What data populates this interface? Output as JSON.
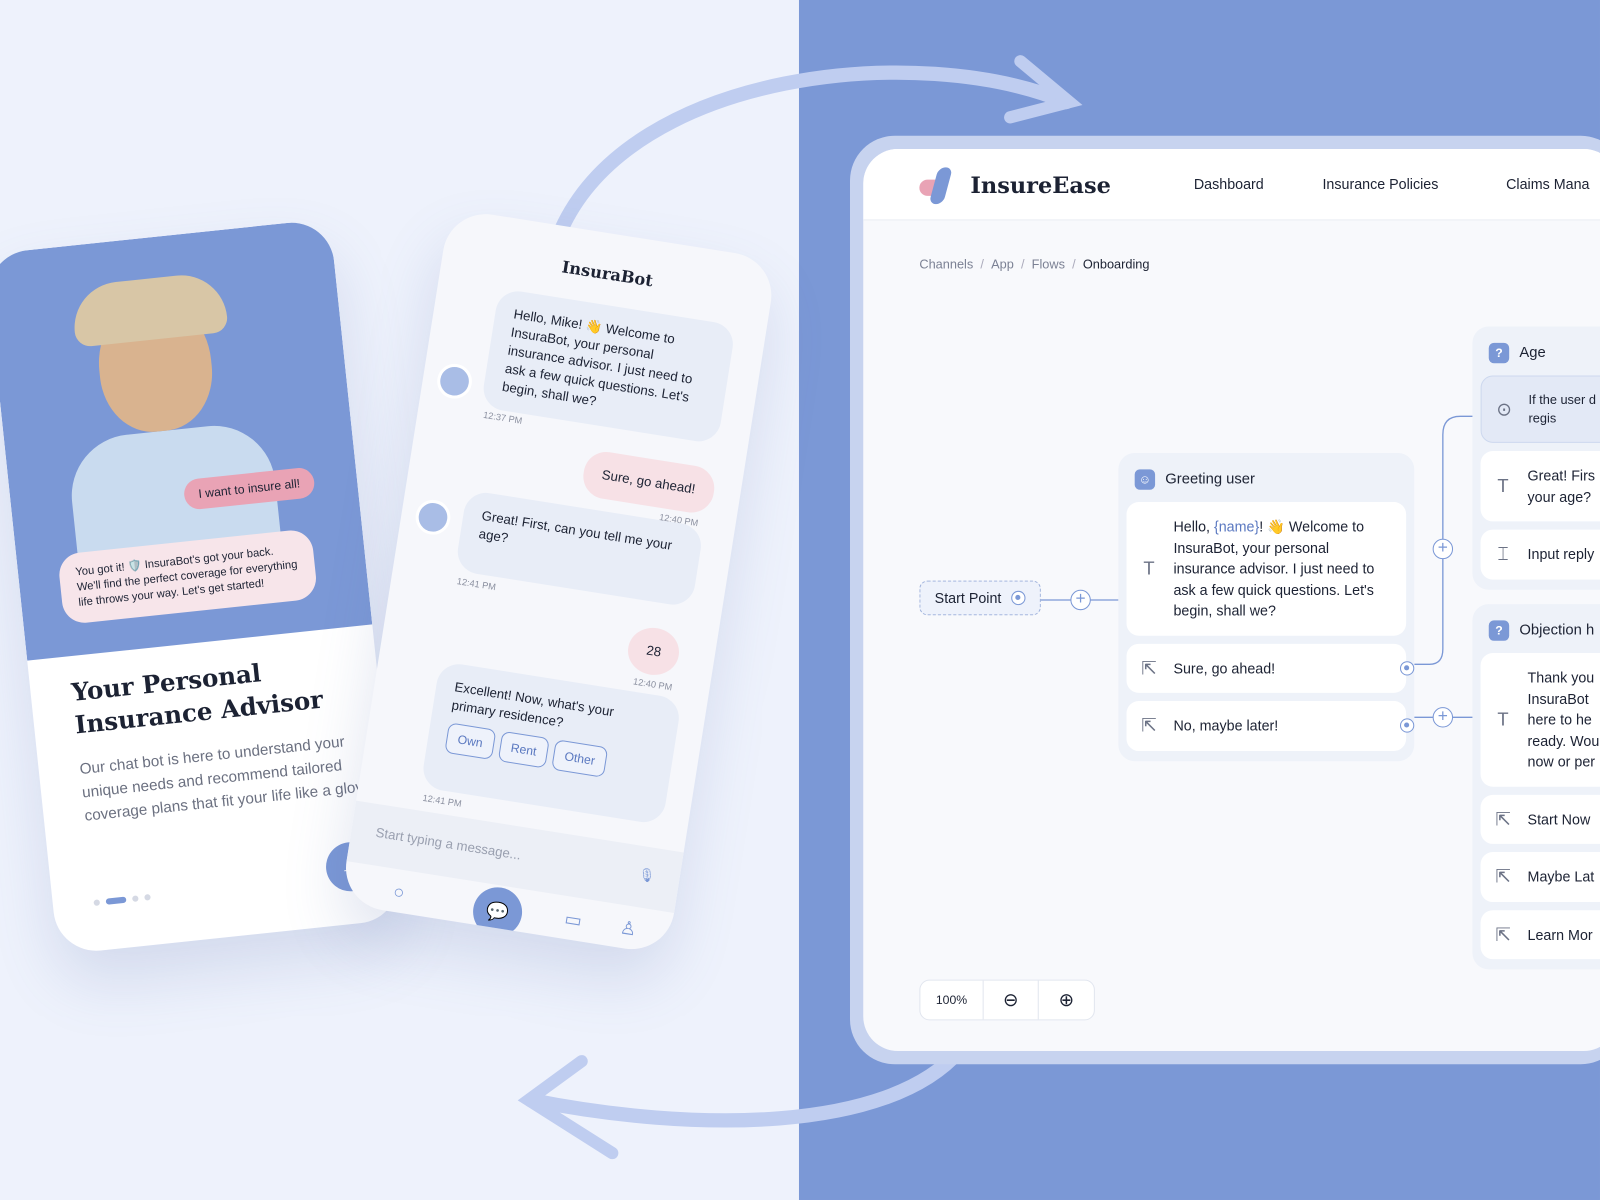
{
  "colors": {
    "accent": "#7b98d6",
    "pink": "#e9a3b5",
    "background": "#eef2fc"
  },
  "onboarding": {
    "bubble_user": "I want to insure all!",
    "bubble_bot": "You got it! 🛡️ InsuraBot's got your back. We'll find the perfect coverage for everything life throws your way. Let's get started!",
    "title": "Your Personal Insurance Advisor",
    "description": "Our chat bot is here to understand your unique needs and recommend tailored coverage plans that fit your life like a glove.",
    "next_icon": "arrow-right-icon"
  },
  "chat": {
    "title": "InsuraBot",
    "messages": [
      {
        "from": "bot",
        "text": "Hello, Mike! 👋 Welcome to InsuraBot, your personal insurance advisor. I just need to ask a few quick questions. Let's begin, shall we?",
        "time": "12:37 PM"
      },
      {
        "from": "user",
        "text": "Sure, go ahead!",
        "time": "12:40 PM"
      },
      {
        "from": "bot",
        "text": "Great! First, can you tell me your age?",
        "time": "12:41 PM"
      },
      {
        "from": "user",
        "text": "28",
        "time": "12:40 PM"
      },
      {
        "from": "bot",
        "text": "Excellent! Now, what's your primary residence?",
        "time": "12:41 PM"
      }
    ],
    "options": [
      "Own",
      "Rent",
      "Other"
    ],
    "composer_placeholder": "Start typing a message..."
  },
  "dashboard": {
    "brand": "InsureEase",
    "nav": [
      "Dashboard",
      "Insurance Policies",
      "Claims Mana"
    ],
    "breadcrumb": [
      "Channels",
      "App",
      "Flows",
      "Onboarding"
    ],
    "start_point": "Start Point",
    "greeting": {
      "title": "Greeting user",
      "message_pre": "Hello, ",
      "message_var": "{name}",
      "message_post": "! 👋 Welcome to InsuraBot, your personal insurance advisor. I just need to ask a few quick questions. Let's begin, shall we?",
      "replies": [
        "Sure, go ahead!",
        "No, maybe later!"
      ]
    },
    "age": {
      "title": "Age",
      "condition": "If the user d during regis",
      "message": "Great! Firs your age?",
      "input": "Input reply"
    },
    "objection": {
      "title": "Objection h",
      "message": "Thank you InsuraBot here to he ready. Wou now or per",
      "replies": [
        "Start Now",
        "Maybe Lat",
        "Learn Mor"
      ]
    },
    "zoom": "100%"
  }
}
